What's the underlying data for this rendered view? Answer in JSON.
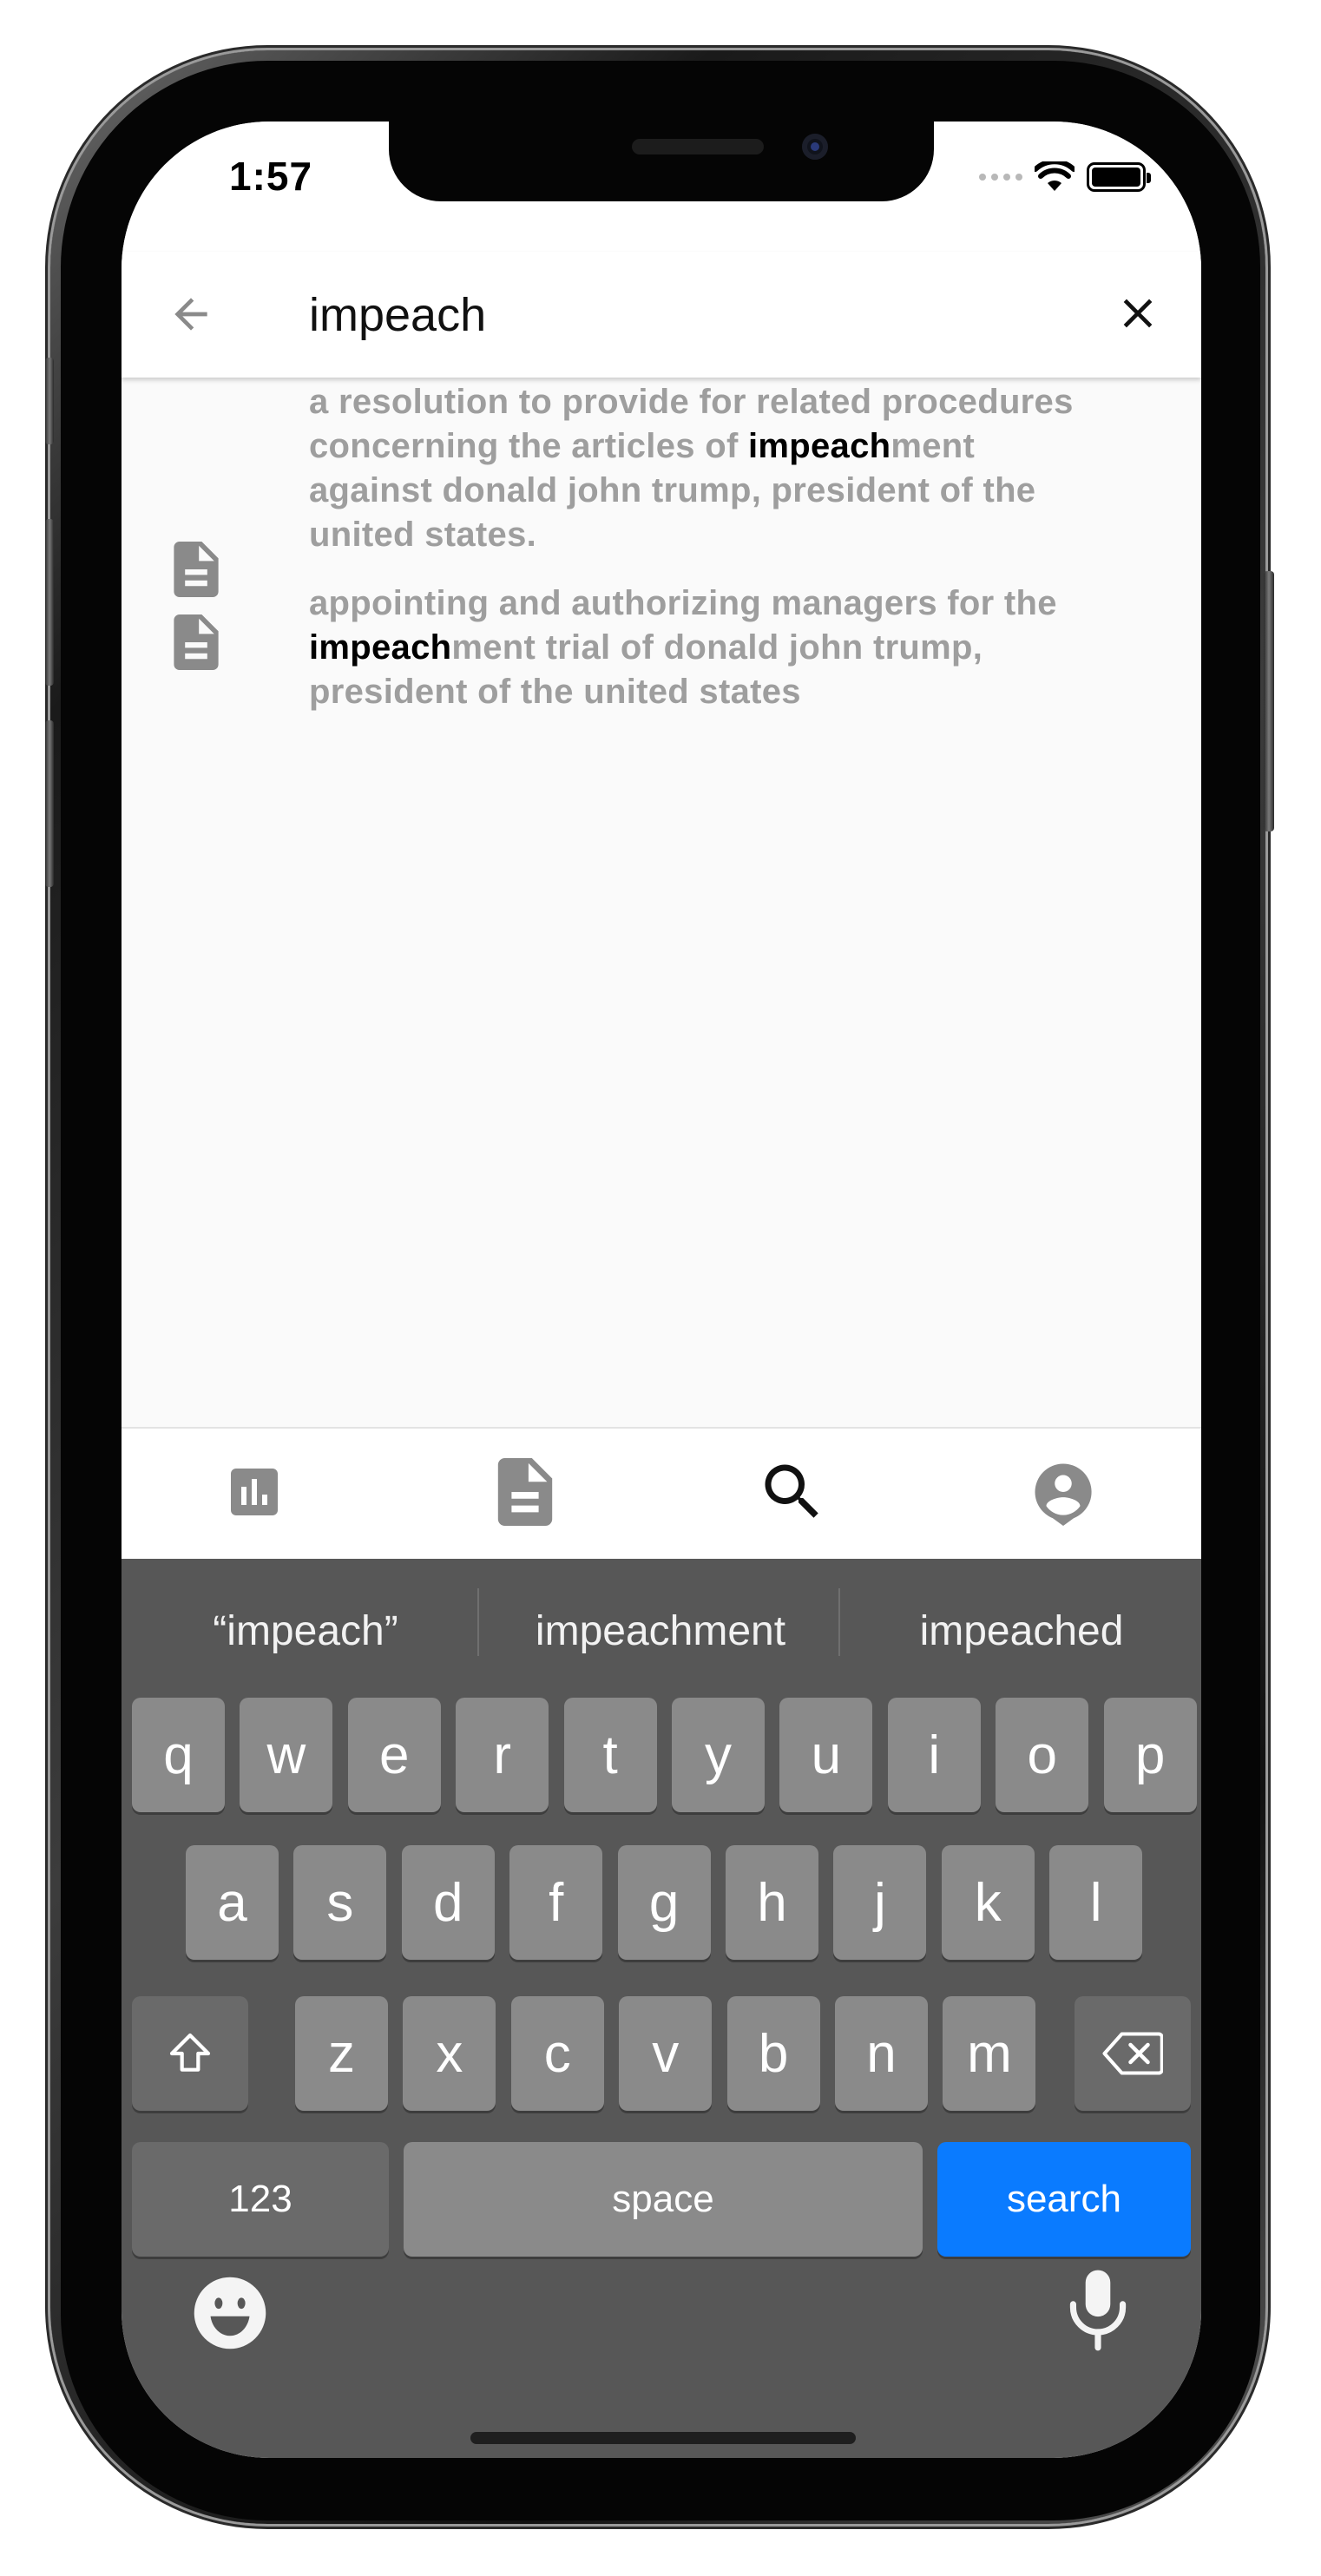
{
  "status_bar": {
    "time": "1:57"
  },
  "search": {
    "query": "impeach"
  },
  "results": [
    {
      "lines": [
        [
          {
            "t": "a resolution to provide for related procedures",
            "hl": false
          }
        ],
        [
          {
            "t": "concerning the articles of ",
            "hl": false
          },
          {
            "t": "impeach",
            "hl": true
          },
          {
            "t": "ment",
            "hl": false
          }
        ],
        [
          {
            "t": "against donald john trump, president of the",
            "hl": false
          }
        ],
        [
          {
            "t": "united states.",
            "hl": false
          }
        ]
      ]
    },
    {
      "lines": [
        [
          {
            "t": "appointing and authorizing managers for the",
            "hl": false
          }
        ],
        [
          {
            "t": "impeach",
            "hl": true
          },
          {
            "t": "ment trial of donald john trump,",
            "hl": false
          }
        ],
        [
          {
            "t": "president of the united states",
            "hl": false
          }
        ]
      ]
    }
  ],
  "bottom_nav": {
    "items": [
      {
        "icon": "bar-chart-icon",
        "active": false
      },
      {
        "icon": "document-icon",
        "active": false
      },
      {
        "icon": "search-icon",
        "active": true
      },
      {
        "icon": "person-pin-icon",
        "active": false
      }
    ]
  },
  "keyboard": {
    "suggestions": [
      "“impeach”",
      "impeachment",
      "impeached"
    ],
    "row1": [
      "q",
      "w",
      "e",
      "r",
      "t",
      "y",
      "u",
      "i",
      "o",
      "p"
    ],
    "row2": [
      "a",
      "s",
      "d",
      "f",
      "g",
      "h",
      "j",
      "k",
      "l"
    ],
    "row3": [
      "z",
      "x",
      "c",
      "v",
      "b",
      "n",
      "m"
    ],
    "numbers_label": "123",
    "space_label": "space",
    "search_label": "search"
  },
  "colors": {
    "result_text": "#9e9e9e",
    "highlight_text": "#000000",
    "search_key": "#0a7bff",
    "keyboard_bg": "#575757",
    "key_bg": "#8a8a8a"
  }
}
